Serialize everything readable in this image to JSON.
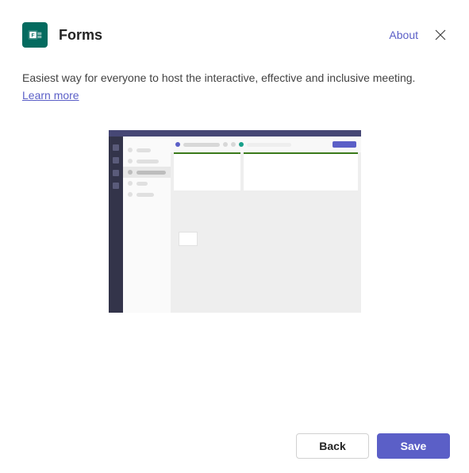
{
  "header": {
    "title": "Forms",
    "about_label": "About"
  },
  "body": {
    "description": "Easiest way for everyone to host the interactive, effective and inclusive meeting.",
    "learn_more_label": "Learn more"
  },
  "footer": {
    "back_label": "Back",
    "save_label": "Save"
  },
  "icons": {
    "app": "forms-icon",
    "close": "close-icon"
  },
  "colors": {
    "brand": "#036b5f",
    "primary": "#5b5fc7",
    "teams_dark": "#464775"
  }
}
